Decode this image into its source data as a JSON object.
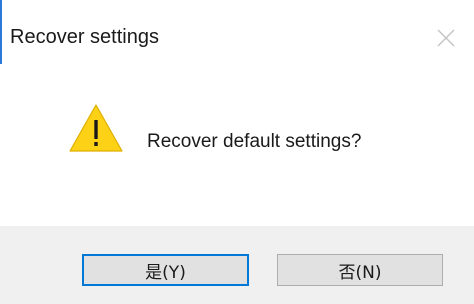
{
  "dialog": {
    "title": "Recover settings",
    "message": "Recover default settings?",
    "icon": "warning-icon",
    "buttons": {
      "yes_label": "是(Y)",
      "no_label": "否(N)"
    },
    "colors": {
      "accent": "#0078d7",
      "warning_fill": "#fcd116",
      "footer_bg": "#f0f0f0"
    }
  }
}
